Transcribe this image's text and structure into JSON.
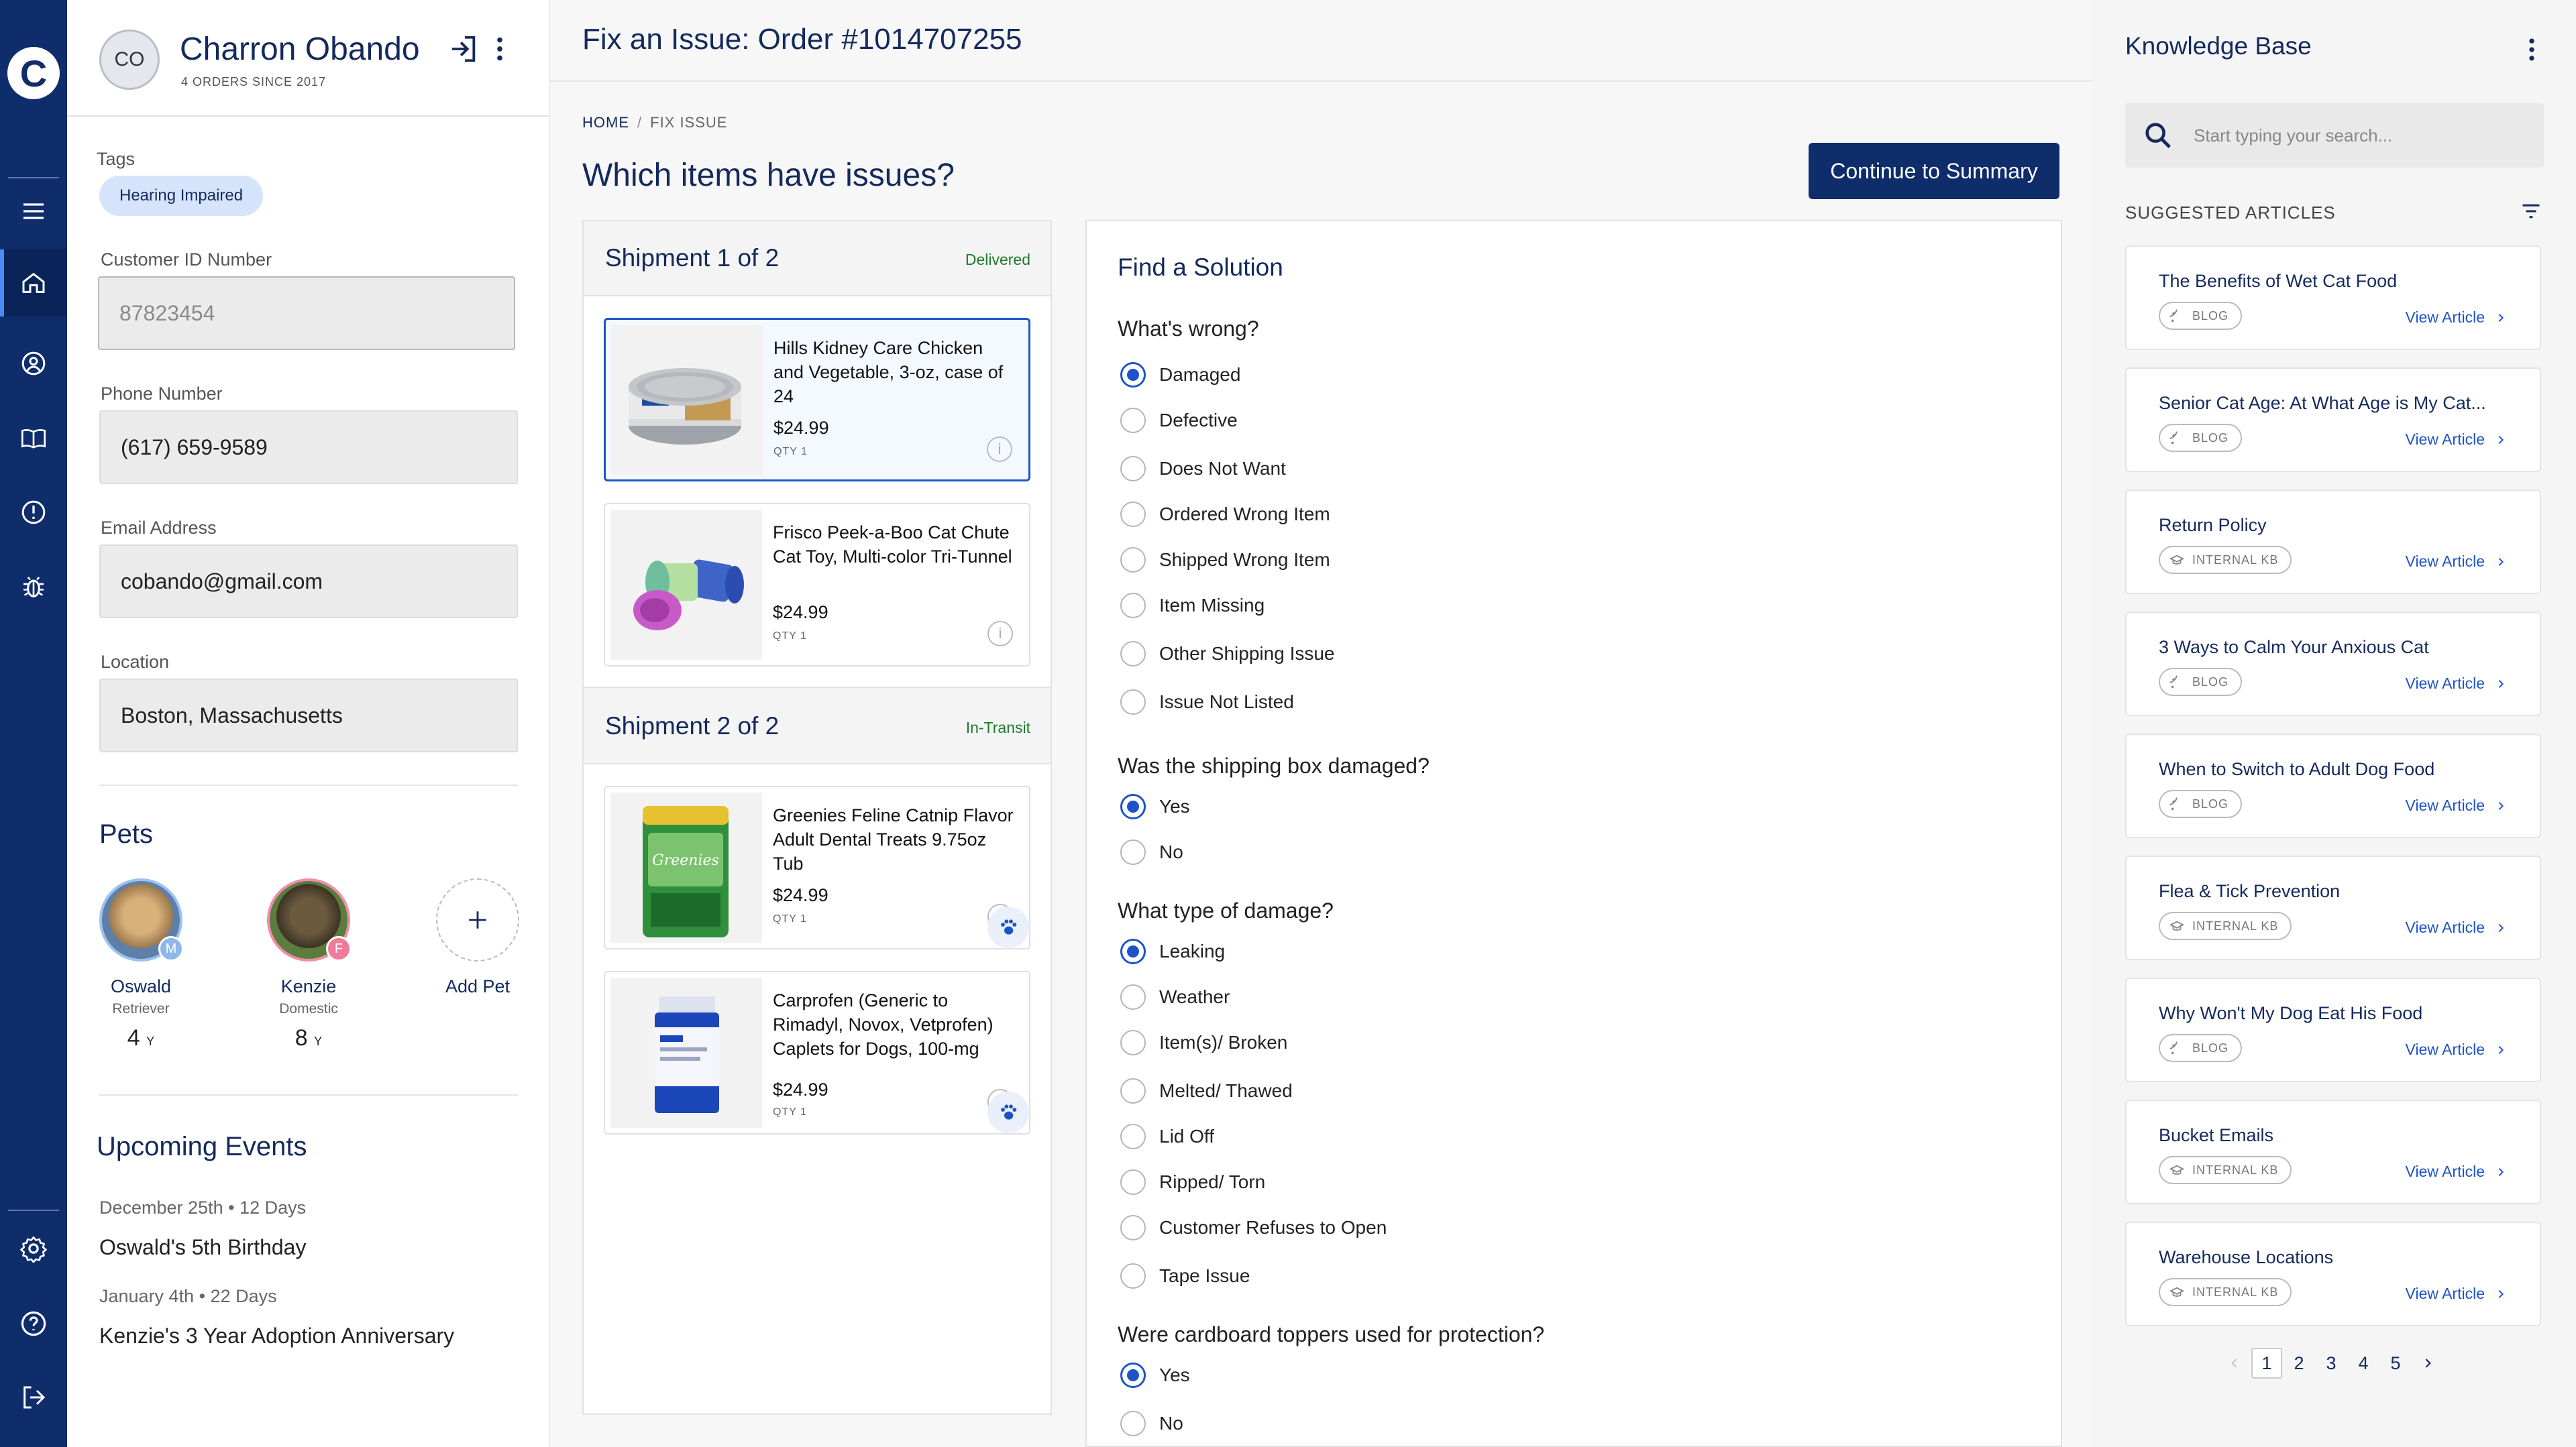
{
  "colors": {
    "rail": "#0f2d6b",
    "accent": "#1c54c8",
    "navy": "#142a5c",
    "success": "#1d7a2a"
  },
  "app": {
    "logo_letter": "C"
  },
  "customer": {
    "initials": "CO",
    "name": "Charron Obando",
    "subtitle": "4 ORDERS SINCE 2017",
    "tags_label": "Tags",
    "tag": "Hearing Impaired",
    "customer_id_label": "Customer ID Number",
    "customer_id": "87823454",
    "phone_label": "Phone Number",
    "phone": "(617) 659-9589",
    "email_label": "Email Address",
    "email": "cobando@gmail.com",
    "location_label": "Location",
    "location": "Boston, Massachusetts"
  },
  "pets": {
    "title": "Pets",
    "items": [
      {
        "name": "Oswald",
        "breed": "Retriever",
        "age": "4",
        "age_unit": "Y",
        "gender": "M"
      },
      {
        "name": "Kenzie",
        "breed": "Domestic",
        "age": "8",
        "age_unit": "Y",
        "gender": "F"
      }
    ],
    "add_label": "Add Pet"
  },
  "events": {
    "title": "Upcoming Events",
    "items": [
      {
        "date": "December 25th • 12 Days",
        "name": "Oswald's 5th Birthday"
      },
      {
        "date": "January 4th • 22 Days",
        "name": "Kenzie's 3 Year Adoption Anniversary"
      }
    ]
  },
  "main": {
    "title": "Fix an Issue: Order #1014707255",
    "breadcrumb": {
      "home": "HOME",
      "sep": "/",
      "current": "FIX ISSUE"
    },
    "question": "Which items have issues?",
    "continue_label": "Continue to Summary"
  },
  "shipments": [
    {
      "title": "Shipment 1 of 2",
      "status": "Delivered",
      "items": [
        {
          "name": "Hills Kidney Care Chicken and Vegetable, 3-oz, case of 24",
          "price": "$24.99",
          "qty": "QTY 1"
        },
        {
          "name": "Frisco Peek-a-Boo Cat Chute Cat Toy, Multi-color Tri-Tunnel",
          "price": "$24.99",
          "qty": "QTY 1"
        }
      ]
    },
    {
      "title": "Shipment 2 of 2",
      "status": "In-Transit",
      "items": [
        {
          "name": "Greenies Feline Catnip Flavor Adult Dental Treats 9.75oz Tub",
          "price": "$24.99",
          "qty": "QTY 1"
        },
        {
          "name": "Carprofen (Generic to Rimadyl, Novox, Vetprofen) Caplets for Dogs, 100-mg",
          "price": "$24.99",
          "qty": "QTY 1"
        }
      ]
    }
  ],
  "product_image_text": {
    "greenies": "Greenies"
  },
  "solution": {
    "title": "Find a Solution",
    "q1": "What's wrong?",
    "q1_options": [
      "Damaged",
      "Defective",
      "Does Not Want",
      "Ordered Wrong Item",
      "Shipped Wrong Item",
      "Item Missing",
      "Other Shipping Issue",
      "Issue Not Listed"
    ],
    "q1_selected": "Damaged",
    "q2": "Was the shipping box damaged?",
    "q2_options": [
      "Yes",
      "No"
    ],
    "q2_selected": "Yes",
    "q3": "What type of damage?",
    "q3_options": [
      "Leaking",
      "Weather",
      "Item(s)/ Broken",
      "Melted/ Thawed",
      "Lid Off",
      "Ripped/ Torn",
      "Customer Refuses to Open",
      "Tape Issue"
    ],
    "q3_selected": "Leaking",
    "q4": "Were cardboard toppers used for protection?",
    "q4_options": [
      "Yes",
      "No"
    ],
    "q4_selected": "Yes"
  },
  "kb": {
    "title": "Knowledge Base",
    "search_placeholder": "Start typing your search...",
    "suggested_label": "SUGGESTED ARTICLES",
    "view_label": "View Article",
    "articles": [
      {
        "title": "The Benefits of Wet Cat Food",
        "badge": "BLOG"
      },
      {
        "title": "Senior Cat Age: At What Age is My Cat...",
        "badge": "BLOG"
      },
      {
        "title": "Return Policy",
        "badge": "INTERNAL KB"
      },
      {
        "title": "3 Ways to Calm Your Anxious Cat",
        "badge": "BLOG"
      },
      {
        "title": "When to Switch to Adult Dog Food",
        "badge": "BLOG"
      },
      {
        "title": "Flea & Tick Prevention",
        "badge": "INTERNAL KB"
      },
      {
        "title": "Why Won't My Dog Eat His Food",
        "badge": "BLOG"
      },
      {
        "title": "Bucket Emails",
        "badge": "INTERNAL KB"
      },
      {
        "title": "Warehouse Locations",
        "badge": "INTERNAL KB"
      }
    ],
    "pages": [
      "1",
      "2",
      "3",
      "4",
      "5"
    ],
    "current_page": "1"
  }
}
